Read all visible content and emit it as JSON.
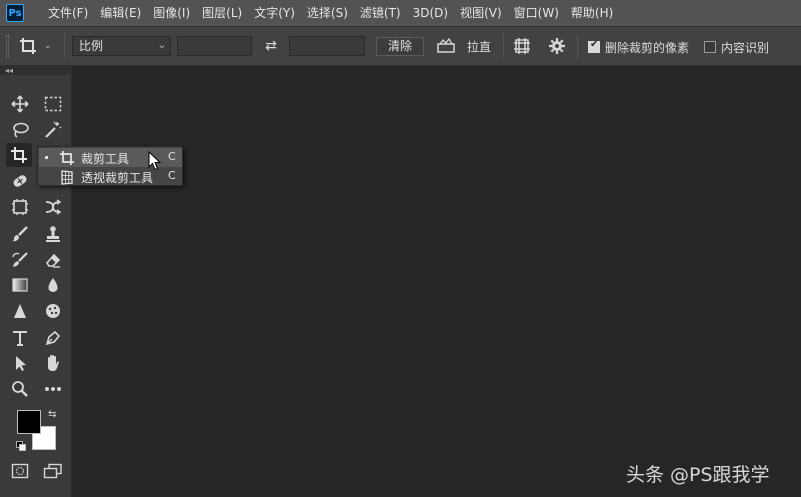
{
  "app": {
    "logo_text": "Ps"
  },
  "menu": [
    "文件(F)",
    "编辑(E)",
    "图像(I)",
    "图层(L)",
    "文字(Y)",
    "选择(S)",
    "滤镜(T)",
    "3D(D)",
    "视图(V)",
    "窗口(W)",
    "帮助(H)"
  ],
  "options": {
    "ratio_select": "比例",
    "width_value": "",
    "height_value": "",
    "clear_label": "清除",
    "straighten_label": "拉直",
    "delete_cropped_label": "删除裁剪的像素",
    "delete_cropped_checked": true,
    "content_aware_label": "内容识别",
    "content_aware_checked": false
  },
  "toolbar": {
    "collapse_glyph": "◂◂"
  },
  "flyout": {
    "items": [
      {
        "label": "裁剪工具",
        "shortcut": "C",
        "selected": true
      },
      {
        "label": "透视裁剪工具",
        "shortcut": "C",
        "selected": false
      }
    ]
  },
  "colors": {
    "foreground": "#000000",
    "background": "#ffffff"
  },
  "watermark": "头条 @PS跟我学"
}
